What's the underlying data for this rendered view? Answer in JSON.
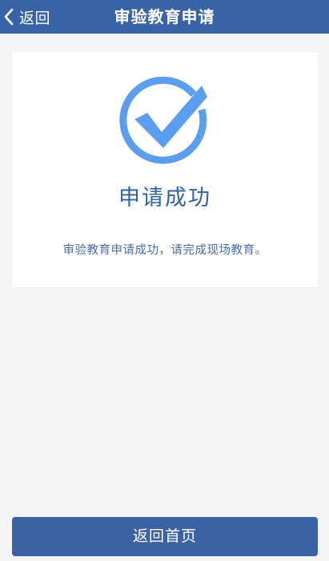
{
  "nav": {
    "back_label": "返回",
    "title": "审验教育申请"
  },
  "result": {
    "icon": "check-circle-icon",
    "title": "申请成功",
    "message": "审验教育申请成功，请完成现场教育。"
  },
  "footer": {
    "home_button_label": "返回首页"
  },
  "colors": {
    "nav_background": "#3a63a5",
    "accent_blue": "#2e62a1",
    "check_blue": "#5b9ef0",
    "page_background": "#f3f4f6",
    "button_background": "#3b63a3"
  }
}
